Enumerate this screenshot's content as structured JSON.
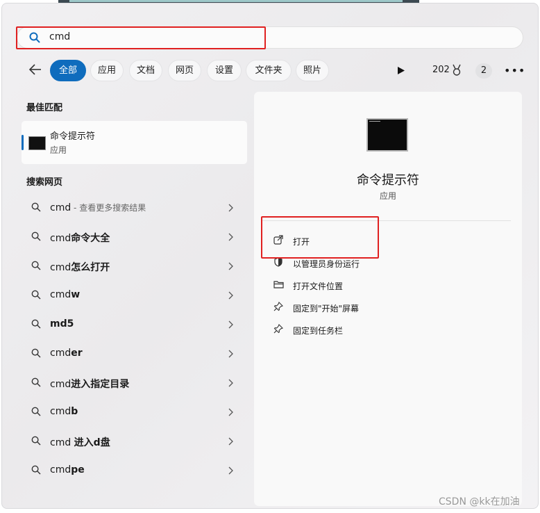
{
  "search": {
    "query": "cmd"
  },
  "filters": [
    {
      "label": "全部",
      "active": true
    },
    {
      "label": "应用"
    },
    {
      "label": "文档"
    },
    {
      "label": "网页"
    },
    {
      "label": "设置"
    },
    {
      "label": "文件夹"
    },
    {
      "label": "照片"
    }
  ],
  "toolbar": {
    "points": "202",
    "badge": "2",
    "more": "•••"
  },
  "best_match": {
    "heading": "最佳匹配",
    "title": "命令提示符",
    "subtitle": "应用"
  },
  "web": {
    "heading": "搜索网页",
    "items": [
      {
        "query": "cmd",
        "bold": "",
        "suffix": " - 查看更多搜索结果"
      },
      {
        "query": "cmd",
        "bold": "命令大全"
      },
      {
        "query": "cmd",
        "bold": "怎么打开"
      },
      {
        "query": "cmd",
        "bold": "w"
      },
      {
        "query": "",
        "bold": "md5"
      },
      {
        "query": "cmd",
        "bold": "er"
      },
      {
        "query": "cmd",
        "bold": "进入指定目录"
      },
      {
        "query": "cmd",
        "bold": "b"
      },
      {
        "query": "cmd ",
        "bold": "进入d盘"
      },
      {
        "query": "cmd",
        "bold": "pe"
      }
    ]
  },
  "detail": {
    "title": "命令提示符",
    "subtitle": "应用",
    "actions": [
      {
        "label": "打开",
        "icon": "open-external-icon"
      },
      {
        "label": "以管理员身份运行",
        "icon": "shield-icon"
      },
      {
        "label": "打开文件位置",
        "icon": "folder-icon"
      },
      {
        "label": "固定到\"开始\"屏幕",
        "icon": "pin-icon"
      },
      {
        "label": "固定到任务栏",
        "icon": "pin-icon"
      }
    ]
  },
  "watermark": "CSDN @kk在加油",
  "colors": {
    "accent": "#0f6cbd",
    "highlight": "#e02020"
  }
}
